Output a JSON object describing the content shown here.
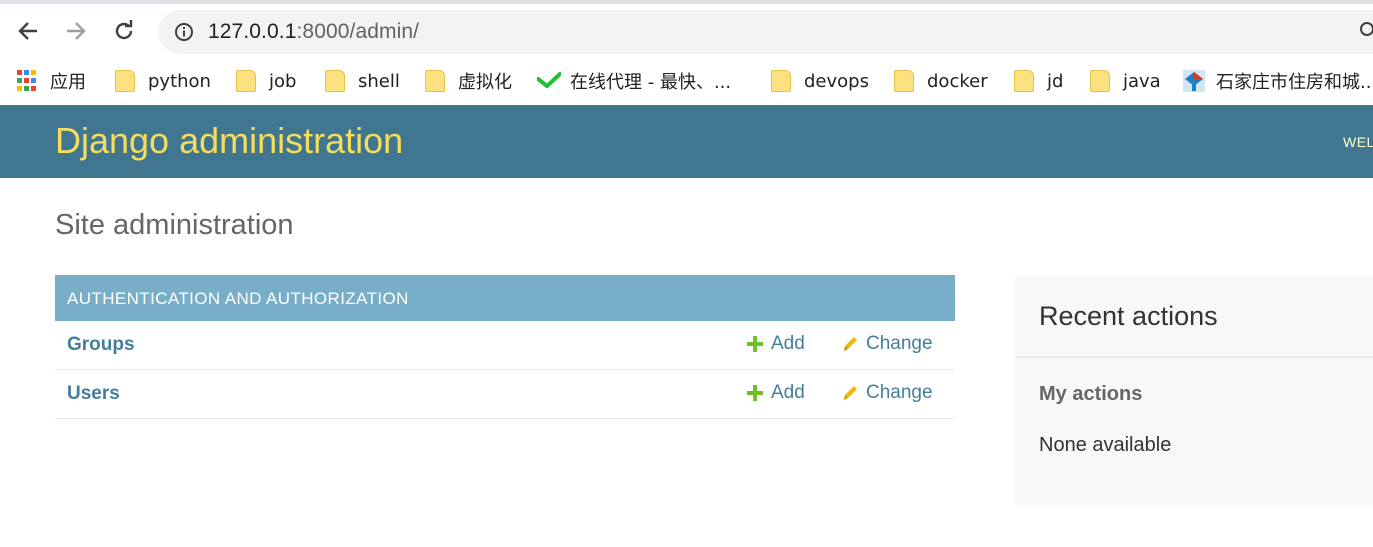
{
  "browser": {
    "url_host": "127.0.0.1",
    "url_rest": ":8000/admin/"
  },
  "bookmarks": [
    {
      "label": "应用",
      "icon": "apps-grid-icon"
    },
    {
      "label": "python",
      "icon": "folder-icon"
    },
    {
      "label": "job",
      "icon": "folder-icon"
    },
    {
      "label": "shell",
      "icon": "folder-icon"
    },
    {
      "label": "虚拟化",
      "icon": "folder-icon"
    },
    {
      "label": "在线代理 - 最快、...",
      "icon": "check-mark-icon"
    },
    {
      "label": "devops",
      "icon": "folder-icon"
    },
    {
      "label": "docker",
      "icon": "folder-icon"
    },
    {
      "label": "jd",
      "icon": "folder-icon"
    },
    {
      "label": "java",
      "icon": "folder-icon"
    },
    {
      "label": "石家庄市住房和城...",
      "icon": "site-logo-icon"
    }
  ],
  "header": {
    "branding": "Django administration",
    "user_tools": "WEL"
  },
  "main": {
    "title": "Site administration",
    "module": {
      "caption": "AUTHENTICATION AND AUTHORIZATION",
      "rows": [
        {
          "name": "Groups",
          "add": "Add",
          "change": "Change"
        },
        {
          "name": "Users",
          "add": "Add",
          "change": "Change"
        }
      ]
    }
  },
  "sidebar": {
    "title": "Recent actions",
    "subtitle": "My actions",
    "empty": "None available"
  },
  "colors": {
    "header_bg": "#417690",
    "branding": "#f5dd5d",
    "caption_bg": "#79aec8",
    "link": "#447e9b",
    "add_icon": "#70bf2b",
    "change_icon": "#efb80b"
  }
}
